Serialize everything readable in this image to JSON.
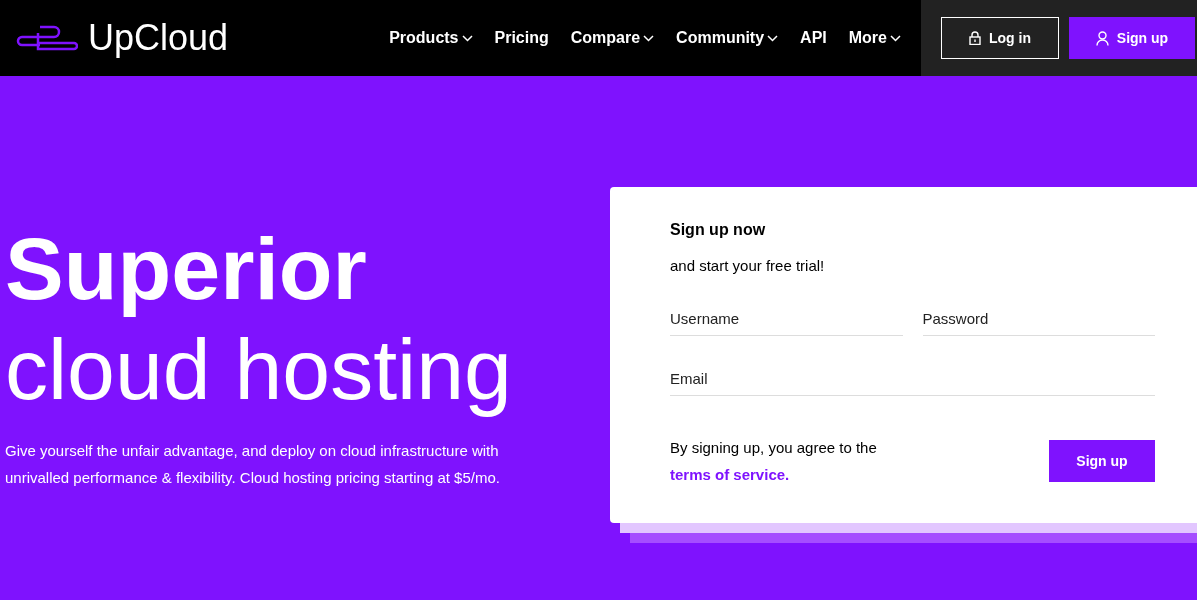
{
  "header": {
    "logo": "UpCloud",
    "nav": [
      {
        "label": "Products",
        "has_menu": true
      },
      {
        "label": "Pricing",
        "has_menu": false
      },
      {
        "label": "Compare",
        "has_menu": true
      },
      {
        "label": "Community",
        "has_menu": true
      },
      {
        "label": "API",
        "has_menu": false
      },
      {
        "label": "More",
        "has_menu": true
      }
    ],
    "login": "Log in",
    "signup": "Sign up"
  },
  "hero": {
    "title_bold": "Superior",
    "title_light": "cloud hosting",
    "text": "Give yourself the unfair advantage, and deploy on cloud infrastructure with unrivalled performance & flexibility. Cloud hosting pricing starting at $5/mo."
  },
  "form": {
    "title": "Sign up now",
    "subtitle": "and start your free trial!",
    "fields": [
      {
        "placeholder": "Username"
      },
      {
        "placeholder": "Password"
      },
      {
        "placeholder": "Email"
      }
    ],
    "agree": "By signing up, you agree to the",
    "terms": "terms of service.",
    "submit": "Sign up"
  }
}
